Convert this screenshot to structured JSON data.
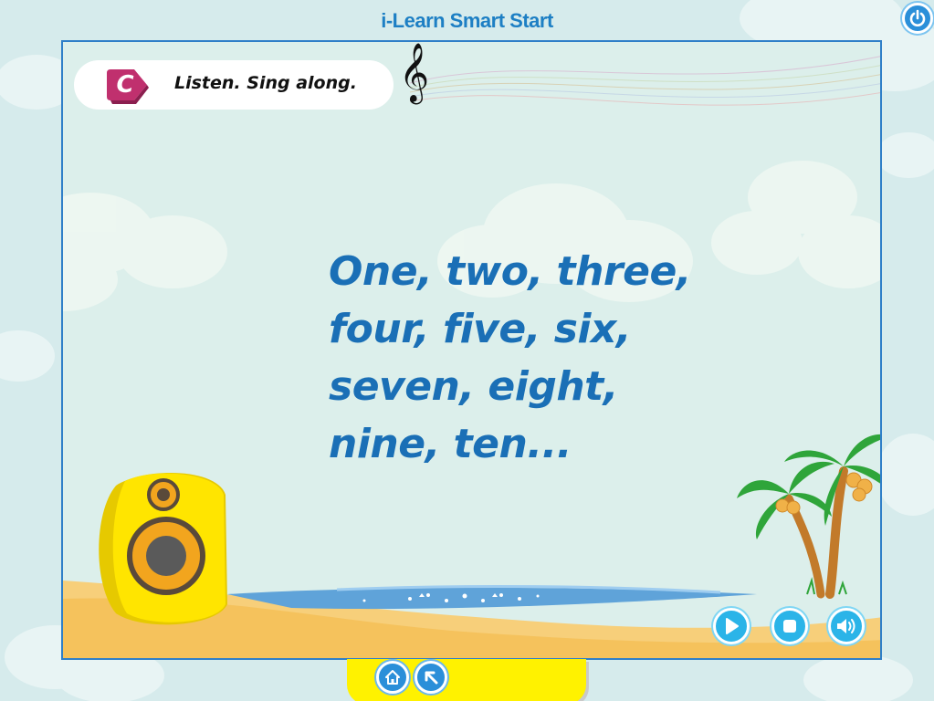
{
  "app": {
    "title": "i-Learn Smart Start"
  },
  "activity": {
    "badge_letter": "C",
    "instruction": "Listen. Sing along.",
    "clef_symbol": "𝄞"
  },
  "lyrics": {
    "lines": [
      "One, two, three,",
      "four, five, six,",
      "seven, eight,",
      "nine, ten..."
    ]
  },
  "controls": {
    "play_icon": "play-icon",
    "stop_icon": "stop-icon",
    "volume_icon": "volume-icon"
  },
  "nav": {
    "home_icon": "home-icon",
    "back_icon": "back-arrow-icon"
  },
  "colors": {
    "brand_blue": "#1d7fc4",
    "lyric_blue": "#1a6fb6",
    "badge_magenta": "#c0306e",
    "control_cyan": "#2bb4e8",
    "speaker_yellow": "#ffe500",
    "nav_bar_yellow": "#fff200"
  }
}
